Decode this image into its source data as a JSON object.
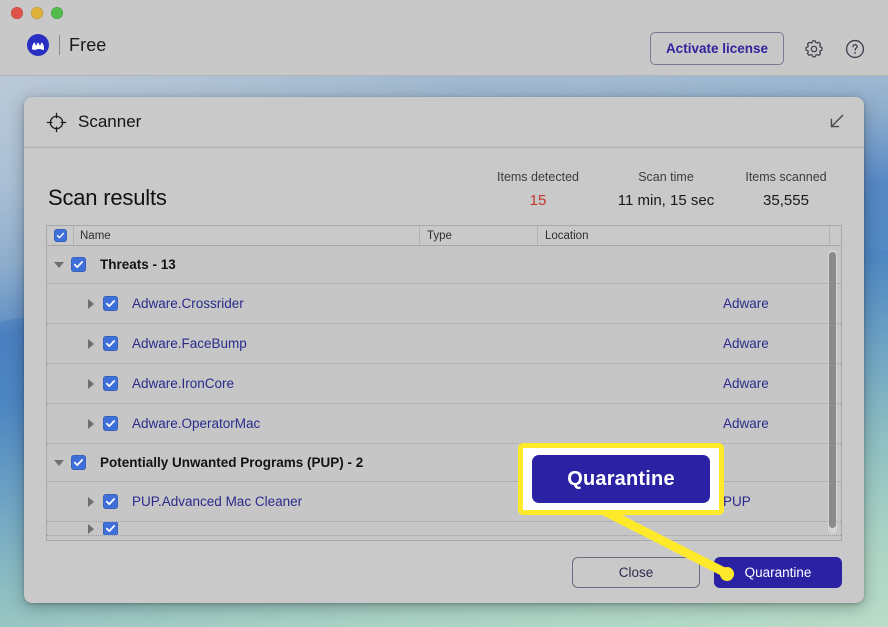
{
  "window": {
    "traffic_lights": [
      "close",
      "minimize",
      "zoom"
    ],
    "brand_edition": "Free",
    "brand_logo_icon": "malwarebytes-m-logo",
    "activate_license_label": "Activate license",
    "settings_icon": "gear-icon",
    "help_icon": "question-circle-icon"
  },
  "panel": {
    "title": "Scanner",
    "title_icon": "crosshair-target-icon",
    "minimize_icon": "collapse-arrow-icon",
    "results_title": "Scan results",
    "close_label": "Close",
    "quarantine_label": "Quarantine"
  },
  "stats": [
    {
      "label": "Items detected",
      "value": "15",
      "alert": true
    },
    {
      "label": "Scan time",
      "value": "11 min, 15 sec",
      "alert": false
    },
    {
      "label": "Items scanned",
      "value": "35,555",
      "alert": false
    }
  ],
  "table": {
    "columns": [
      "Name",
      "Type",
      "Location"
    ],
    "header_checkbox_checked": true,
    "groups": [
      {
        "label": "Threats - 13",
        "checked": true,
        "expanded": true,
        "items": [
          {
            "name": "Adware.Crossrider",
            "type": "Adware",
            "location": "",
            "checked": true
          },
          {
            "name": "Adware.FaceBump",
            "type": "Adware",
            "location": "",
            "checked": true
          },
          {
            "name": "Adware.IronCore",
            "type": "Adware",
            "location": "",
            "checked": true
          },
          {
            "name": "Adware.OperatorMac",
            "type": "Adware",
            "location": "",
            "checked": true
          }
        ]
      },
      {
        "label": "Potentially Unwanted Programs (PUP) - 2",
        "checked": true,
        "expanded": true,
        "items": [
          {
            "name": "PUP.Advanced Mac Cleaner",
            "type": "PUP",
            "location": "",
            "checked": true
          },
          {
            "name": "",
            "type": "",
            "location": "",
            "checked": true
          }
        ]
      }
    ]
  },
  "annotation": {
    "callout_label": "Quarantine",
    "highlight_color": "#ffe92b",
    "button_color": "#2a22a3"
  },
  "colors": {
    "accent_blue": "#2a22a3",
    "checkbox_blue": "#3f6fd8",
    "link_text": "#2b2a8c",
    "alert_red": "#c0392b",
    "chrome_gray": "#c8c8c8"
  }
}
